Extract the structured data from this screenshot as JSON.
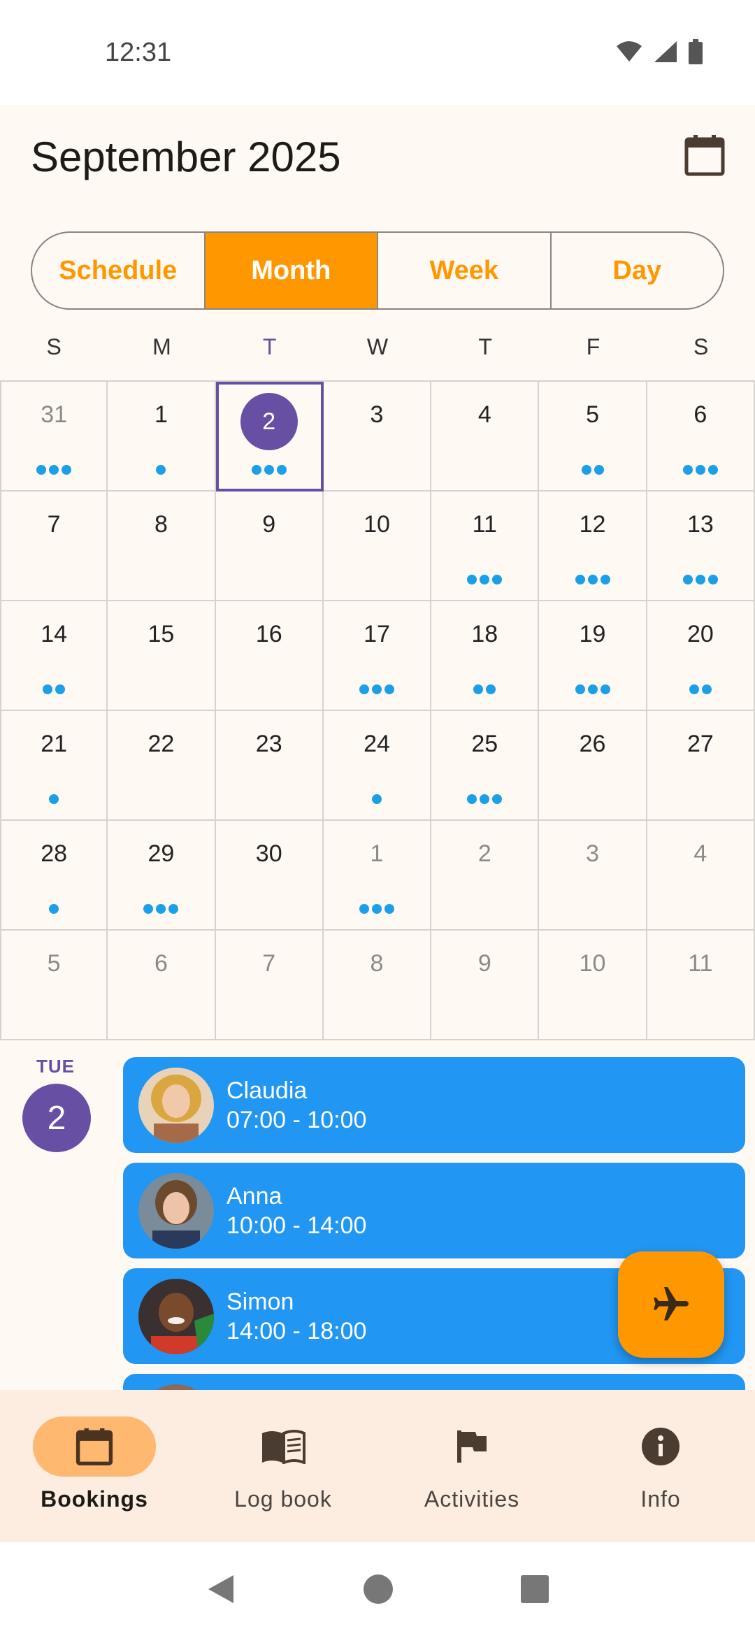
{
  "status_bar": {
    "time": "12:31"
  },
  "header": {
    "title": "September 2025"
  },
  "view_tabs": [
    {
      "label": "Schedule",
      "active": false
    },
    {
      "label": "Month",
      "active": true
    },
    {
      "label": "Week",
      "active": false
    },
    {
      "label": "Day",
      "active": false
    }
  ],
  "weekdays": [
    "S",
    "M",
    "T",
    "W",
    "T",
    "F",
    "S"
  ],
  "calendar": {
    "today_column": 2,
    "days": [
      {
        "d": "31",
        "muted": true,
        "dots": 3
      },
      {
        "d": "1",
        "dots": 1
      },
      {
        "d": "2",
        "today": true,
        "dots": 3
      },
      {
        "d": "3",
        "dots": 0
      },
      {
        "d": "4",
        "dots": 0
      },
      {
        "d": "5",
        "dots": 2
      },
      {
        "d": "6",
        "dots": 3
      },
      {
        "d": "7",
        "dots": 0
      },
      {
        "d": "8",
        "dots": 0
      },
      {
        "d": "9",
        "dots": 0
      },
      {
        "d": "10",
        "dots": 0
      },
      {
        "d": "11",
        "dots": 3
      },
      {
        "d": "12",
        "dots": 3
      },
      {
        "d": "13",
        "dots": 3
      },
      {
        "d": "14",
        "dots": 2
      },
      {
        "d": "15",
        "dots": 0
      },
      {
        "d": "16",
        "dots": 0
      },
      {
        "d": "17",
        "dots": 3
      },
      {
        "d": "18",
        "dots": 2
      },
      {
        "d": "19",
        "dots": 3
      },
      {
        "d": "20",
        "dots": 2
      },
      {
        "d": "21",
        "dots": 1
      },
      {
        "d": "22",
        "dots": 0
      },
      {
        "d": "23",
        "dots": 0
      },
      {
        "d": "24",
        "dots": 1
      },
      {
        "d": "25",
        "dots": 3
      },
      {
        "d": "26",
        "dots": 0
      },
      {
        "d": "27",
        "dots": 0
      },
      {
        "d": "28",
        "dots": 1
      },
      {
        "d": "29",
        "dots": 3
      },
      {
        "d": "30",
        "dots": 0
      },
      {
        "d": "1",
        "muted": true,
        "dots": 3
      },
      {
        "d": "2",
        "muted": true,
        "dots": 0
      },
      {
        "d": "3",
        "muted": true,
        "dots": 0
      },
      {
        "d": "4",
        "muted": true,
        "dots": 0
      },
      {
        "d": "5",
        "muted": true,
        "dots": 0
      },
      {
        "d": "6",
        "muted": true,
        "dots": 0
      },
      {
        "d": "7",
        "muted": true,
        "dots": 0
      },
      {
        "d": "8",
        "muted": true,
        "dots": 0
      },
      {
        "d": "9",
        "muted": true,
        "dots": 0
      },
      {
        "d": "10",
        "muted": true,
        "dots": 0
      },
      {
        "d": "11",
        "muted": true,
        "dots": 0
      }
    ]
  },
  "agenda": {
    "day_name": "TUE",
    "day_number": "2",
    "bookings": [
      {
        "name": "Claudia",
        "time": "07:00 - 10:00",
        "avatar": "claudia"
      },
      {
        "name": "Anna",
        "time": "10:00 - 14:00",
        "avatar": "anna"
      },
      {
        "name": "Simon",
        "time": "14:00 - 18:00",
        "avatar": "simon"
      },
      {
        "name": "",
        "time": "",
        "avatar": "partial"
      }
    ]
  },
  "fab": {
    "icon": "airplane-icon"
  },
  "bottom_nav": [
    {
      "label": "Bookings",
      "icon": "calendar-icon",
      "active": true
    },
    {
      "label": "Log book",
      "icon": "book-icon",
      "active": false
    },
    {
      "label": "Activities",
      "icon": "flag-icon",
      "active": false
    },
    {
      "label": "Info",
      "icon": "info-icon",
      "active": false
    }
  ],
  "colors": {
    "accent": "#ff9800",
    "today": "#6750a4",
    "booking": "#2196f3",
    "event_dot": "#1ba0e8",
    "nav_bg": "#fcede0",
    "nav_active": "#ffb870"
  }
}
